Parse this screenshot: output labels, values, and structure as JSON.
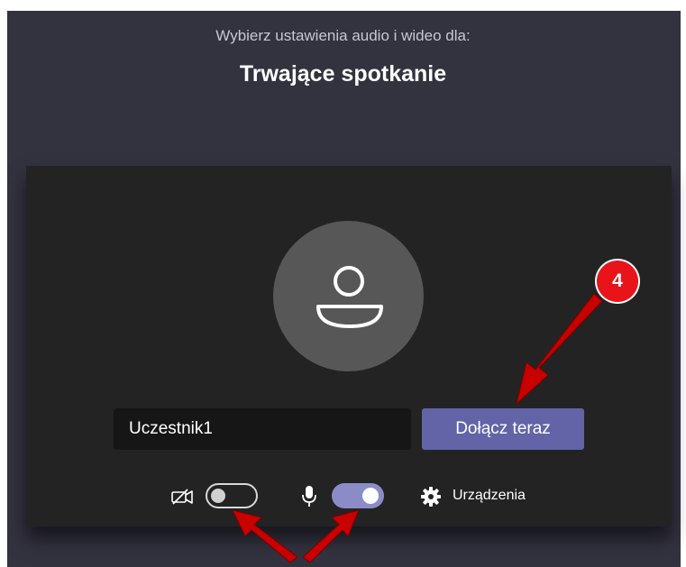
{
  "header": {
    "subtitle": "Wybierz ustawienia audio i wideo dla:",
    "title": "Trwające spotkanie"
  },
  "join": {
    "name_value": "Uczestnik1",
    "join_label": "Dołącz teraz"
  },
  "controls": {
    "camera": {
      "icon": "camera-off-icon",
      "state": "off"
    },
    "microphone": {
      "icon": "microphone-icon",
      "state": "on"
    },
    "devices_label": "Urządzenia",
    "devices_icon": "gear-icon"
  },
  "annotation": {
    "step_badge": "4"
  },
  "colors": {
    "background": "#33323f",
    "panel": "#232323",
    "accent": "#6264a7",
    "toggle_on": "#8b8cc7",
    "annotation_red": "#e8141a"
  }
}
